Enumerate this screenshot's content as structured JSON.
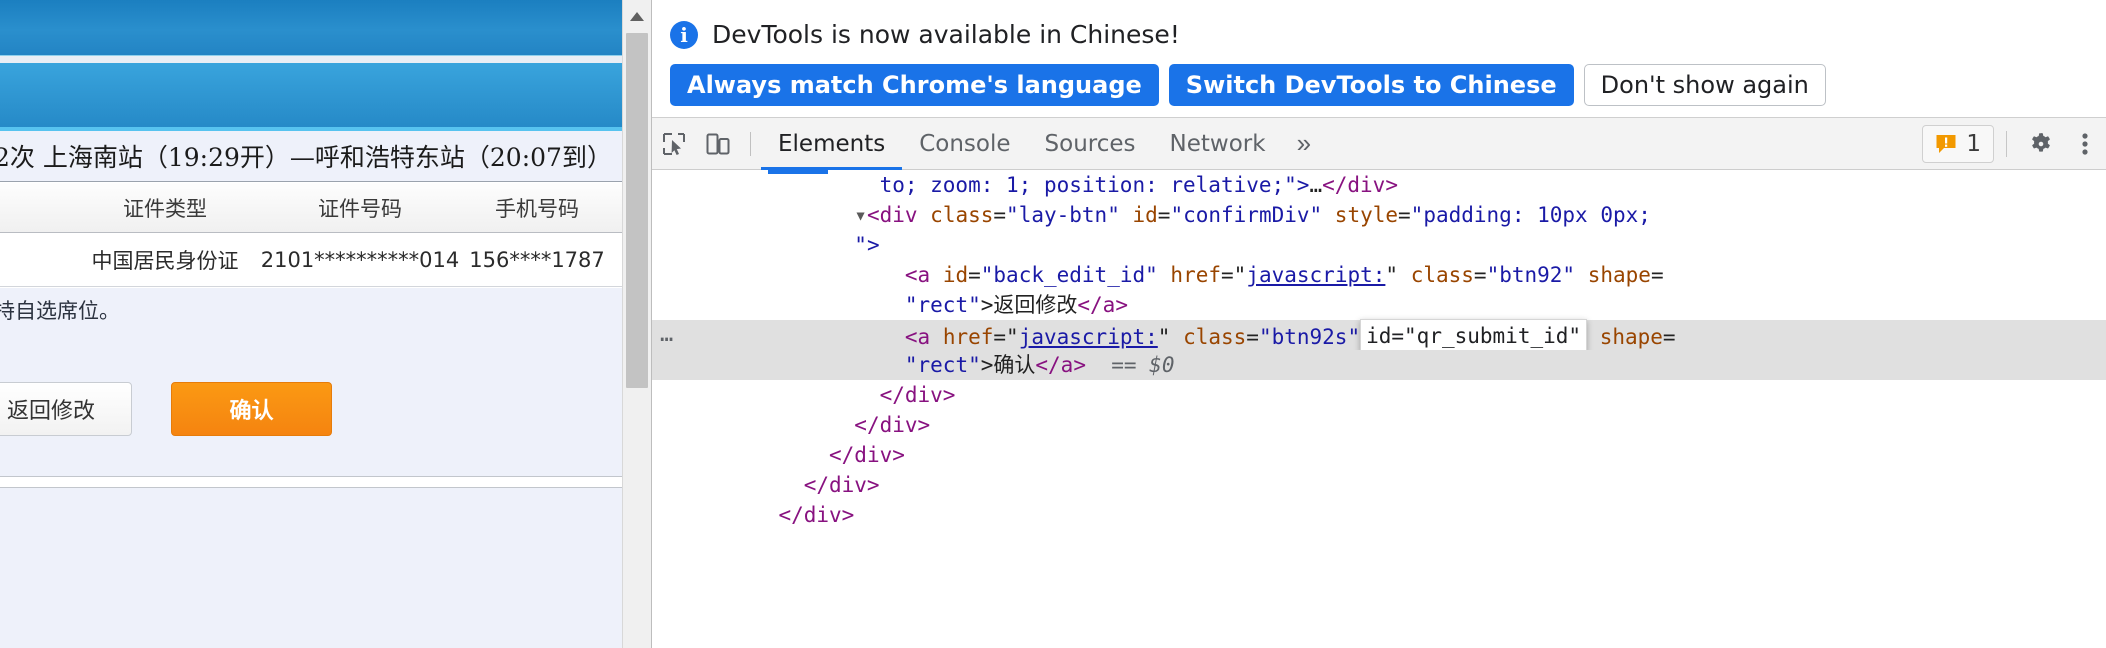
{
  "page": {
    "train_info": "2次 上海南站（19:29开）—呼和浩特东站（20:07到）",
    "table_headers": {
      "id_type": "证件类型",
      "id_number": "证件号码",
      "phone": "手机号码"
    },
    "passenger_row": {
      "id_type": "中国居民身份证",
      "id_number": "2101**********014",
      "phone": "156****1787"
    },
    "notice": "持自选席位。",
    "buttons": {
      "back_edit": "返回修改",
      "confirm": "确认"
    }
  },
  "devtools": {
    "i18n_bar": {
      "message": "DevTools is now available in Chinese!",
      "info_icon": "info-icon",
      "buttons": [
        {
          "label": "Always match Chrome's language",
          "style": "primary"
        },
        {
          "label": "Switch DevTools to Chinese",
          "style": "primary"
        },
        {
          "label": "Don't show again",
          "style": "ghost"
        }
      ]
    },
    "toolbar": {
      "inspect_icon": "inspect-element-icon",
      "device_icon": "device-toolbar-icon",
      "tabs": [
        {
          "label": "Elements",
          "active": true
        },
        {
          "label": "Console",
          "active": false
        },
        {
          "label": "Sources",
          "active": false
        },
        {
          "label": "Network",
          "active": false
        }
      ],
      "more_tabs_icon": "chevron-double-right-icon",
      "warning_icon": "warning-badge-icon",
      "warning_count": "1",
      "settings_icon": "gear-icon",
      "menu_icon": "kebab-menu-icon"
    },
    "dom_tree": {
      "lines": [
        {
          "id": "line-style-tail",
          "indent": 9,
          "segments": [
            {
              "t": "val",
              "s": "to; zoom: 1; position: relative;"
            },
            {
              "t": "val",
              "s": "\">"
            },
            {
              "t": "txt",
              "s": "…"
            },
            {
              "t": "tag",
              "s": "</div>"
            }
          ]
        },
        {
          "id": "line-confirm-div",
          "indent": 8,
          "segments": [
            {
              "t": "arrow",
              "s": "▾"
            },
            {
              "t": "tag",
              "s": "<div "
            },
            {
              "t": "attr",
              "s": "class"
            },
            {
              "t": "punct",
              "s": "="
            },
            {
              "t": "val",
              "s": "\"lay-btn\""
            },
            {
              "t": "attr",
              "s": " id"
            },
            {
              "t": "punct",
              "s": "="
            },
            {
              "t": "val",
              "s": "\"confirmDiv\""
            },
            {
              "t": "attr",
              "s": " style"
            },
            {
              "t": "punct",
              "s": "="
            },
            {
              "t": "val",
              "s": "\"padding: 10px 0px;"
            }
          ]
        },
        {
          "id": "line-confirm-div-wrap",
          "indent": 8,
          "segments": [
            {
              "t": "val",
              "s": "\">"
            }
          ]
        },
        {
          "id": "line-back-edit",
          "indent": 10,
          "segments": [
            {
              "t": "tag",
              "s": "<a "
            },
            {
              "t": "attr",
              "s": "id"
            },
            {
              "t": "punct",
              "s": "="
            },
            {
              "t": "val",
              "s": "\"back_edit_id\""
            },
            {
              "t": "attr",
              "s": " href"
            },
            {
              "t": "punct",
              "s": "="
            },
            {
              "t": "punct",
              "s": "\""
            },
            {
              "t": "link",
              "s": "javascript:"
            },
            {
              "t": "punct",
              "s": "\""
            },
            {
              "t": "attr",
              "s": " class"
            },
            {
              "t": "punct",
              "s": "="
            },
            {
              "t": "val",
              "s": "\"btn92\""
            },
            {
              "t": "attr",
              "s": " shape"
            },
            {
              "t": "punct",
              "s": "="
            }
          ]
        },
        {
          "id": "line-back-edit-wrap",
          "indent": 10,
          "segments": [
            {
              "t": "val",
              "s": "\"rect\""
            },
            {
              "t": "punct",
              "s": ">"
            },
            {
              "t": "txt",
              "s": "返回修改"
            },
            {
              "t": "tag",
              "s": "</a>"
            }
          ]
        },
        {
          "id": "line-qr-submit",
          "indent": 10,
          "selected": true,
          "gutter": "…",
          "segments": [
            {
              "t": "tag",
              "s": "<a "
            },
            {
              "t": "attr",
              "s": "href"
            },
            {
              "t": "punct",
              "s": "="
            },
            {
              "t": "punct",
              "s": "\""
            },
            {
              "t": "link",
              "s": "javascript:"
            },
            {
              "t": "punct",
              "s": "\""
            },
            {
              "t": "attr",
              "s": " class"
            },
            {
              "t": "punct",
              "s": "="
            },
            {
              "t": "val",
              "s": "\"btn92s\""
            },
            {
              "t": "tip",
              "s": "id=\"qr_submit_id\""
            },
            {
              "t": "attr",
              "s": " shape"
            },
            {
              "t": "punct",
              "s": "="
            }
          ]
        },
        {
          "id": "line-qr-submit-wrap",
          "indent": 10,
          "selected": true,
          "segments": [
            {
              "t": "val",
              "s": "\"rect\""
            },
            {
              "t": "punct",
              "s": ">"
            },
            {
              "t": "txt",
              "s": "确认"
            },
            {
              "t": "tag",
              "s": "</a>"
            },
            {
              "t": "dollar",
              "s": "  == $0"
            }
          ]
        },
        {
          "id": "line-close-1",
          "indent": 9,
          "segments": [
            {
              "t": "tag",
              "s": "</div>"
            }
          ]
        },
        {
          "id": "line-close-2",
          "indent": 8,
          "segments": [
            {
              "t": "tag",
              "s": "</div>"
            }
          ]
        },
        {
          "id": "line-close-3",
          "indent": 7,
          "segments": [
            {
              "t": "tag",
              "s": "</div>"
            }
          ]
        },
        {
          "id": "line-close-4",
          "indent": 6,
          "segments": [
            {
              "t": "tag",
              "s": "</div>"
            }
          ]
        },
        {
          "id": "line-close-5",
          "indent": 5,
          "segments": [
            {
              "t": "tag",
              "s": "</div>"
            }
          ]
        }
      ]
    }
  },
  "colors": {
    "accent_blue": "#1a73e8",
    "orange_button": "#f58410",
    "page_blue": "#2a8fcd",
    "selected_row": "#e0e0e0"
  }
}
